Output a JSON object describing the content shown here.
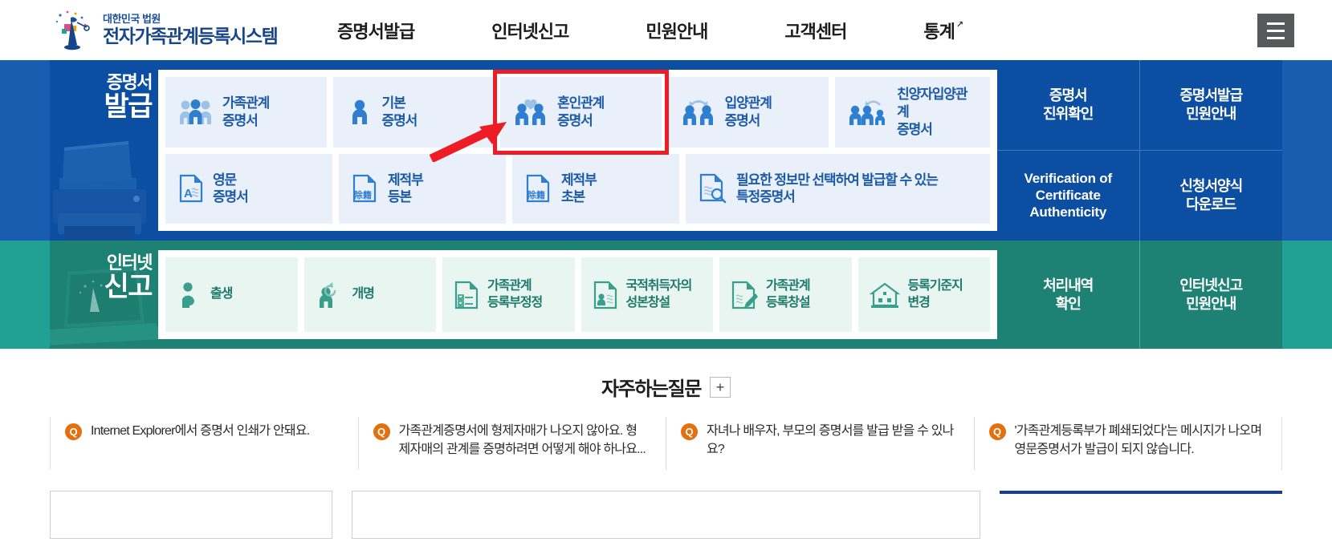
{
  "header": {
    "logo": {
      "icon": "court-emblem-icon",
      "line1": "대한민국 법원",
      "line2": "전자가족관계등록시스템"
    },
    "nav": [
      {
        "label": "증명서발급",
        "external": false
      },
      {
        "label": "인터넷신고",
        "external": false
      },
      {
        "label": "민원안내",
        "external": false
      },
      {
        "label": "고객센터",
        "external": false
      },
      {
        "label": "통계",
        "external": true,
        "external_icon": "external-link-icon"
      }
    ],
    "menu_button": "hamburger-menu-icon"
  },
  "certificate_section": {
    "panel_label_line1": "증명서",
    "panel_label_line2": "발급",
    "panel_background_icon": "printer-icon",
    "accent_color": "#0b4ea2",
    "highlight_color": "#ee1c25",
    "annotation": {
      "type": "arrow",
      "icon": "red-arrow-icon",
      "points_to": "혼인관계 증명서"
    },
    "row1": [
      {
        "label": "가족관계\n증명서",
        "icon": "family-group-icon",
        "highlighted": false
      },
      {
        "label": "기본\n증명서",
        "icon": "single-person-icon",
        "highlighted": false
      },
      {
        "label": "혼인관계\n증명서",
        "icon": "couple-heart-icon",
        "highlighted": true
      },
      {
        "label": "입양관계\n증명서",
        "icon": "adoption-arrows-icon",
        "highlighted": false
      },
      {
        "label": "친양자입양관계\n증명서",
        "icon": "full-adoption-icon",
        "highlighted": false
      }
    ],
    "row2": [
      {
        "label": "영문\n증명서",
        "icon": "document-letter-a-icon",
        "hanja": "",
        "highlighted": false
      },
      {
        "label": "제적부\n등본",
        "icon": "document-icon",
        "hanja": "除籍",
        "highlighted": false
      },
      {
        "label": "제적부\n초본",
        "icon": "document-icon",
        "hanja": "除籍",
        "highlighted": false
      },
      {
        "label": "필요한 정보만 선택하여 발급할 수 있는\n특정증명서",
        "icon": "document-search-icon",
        "hanja": "",
        "highlighted": false,
        "wide": true
      }
    ],
    "side_links": [
      {
        "label": "증명서\n진위확인",
        "lang": "ko"
      },
      {
        "label": "증명서발급\n민원안내",
        "lang": "ko"
      },
      {
        "label": "Verification of\nCertificate\nAuthenticity",
        "lang": "en"
      },
      {
        "label": "신청서양식\n다운로드",
        "lang": "ko"
      }
    ]
  },
  "report_section": {
    "panel_label_line1": "인터넷",
    "panel_label_line2": "신고",
    "panel_background_icon": "laptop-icon",
    "accent_color": "#1d8273",
    "cards": [
      {
        "label": "출생",
        "icon": "pregnant-person-heart-icon"
      },
      {
        "label": "개명",
        "icon": "person-refresh-icon"
      },
      {
        "label": "가족관계\n등록부정정",
        "icon": "checklist-document-icon"
      },
      {
        "label": "국적취득자의\n성본창설",
        "icon": "id-document-icon"
      },
      {
        "label": "가족관계\n등록창설",
        "icon": "document-pencil-icon"
      },
      {
        "label": "등록기준지\n변경",
        "icon": "house-icon"
      }
    ],
    "side_links": [
      {
        "label": "처리내역\n확인"
      },
      {
        "label": "인터넷신고\n민원안내"
      }
    ]
  },
  "faq": {
    "title": "자주하는질문",
    "expand_button": "+",
    "badge_letter": "Q",
    "badge_color": "#e2700f",
    "items": [
      {
        "question": "Internet Explorer에서 증명서 인쇄가 안돼요."
      },
      {
        "question": "가족관계증명서에 형제자매가 나오지 않아요. 형제자매의 관계를 증명하려면 어떻게 해야 하나요..."
      },
      {
        "question": "자녀나 배우자, 부모의 증명서를 발급 받을 수 있나요?"
      },
      {
        "question": "'가족관계등록부가 폐쇄되었다'는 메시지가 나오며 영문증명서가 발급이 되지 않습니다."
      }
    ]
  }
}
